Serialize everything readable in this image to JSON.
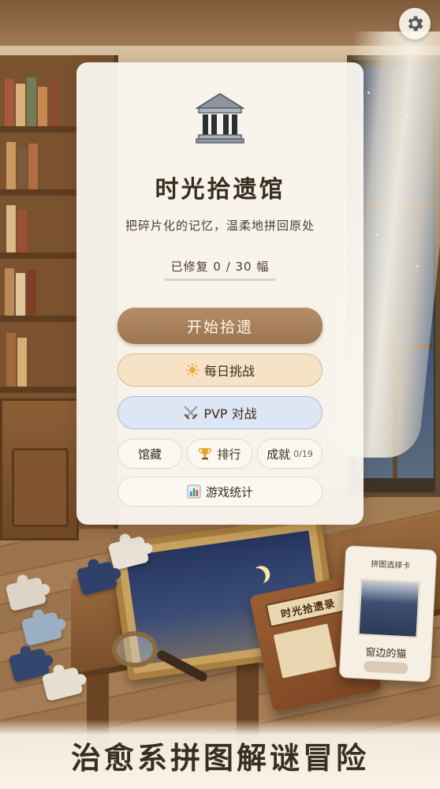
{
  "app": {
    "title": "时光拾遗馆",
    "subtitle": "把碎片化的记忆，温柔地拼回原处"
  },
  "progress": {
    "label": "已修复 0 / 30 幅",
    "restored": 0,
    "total": 30
  },
  "menu": {
    "start_label": "开始拾遗",
    "daily_label": "每日挑战",
    "daily_icon": "sun-icon",
    "pvp_label": "PVP 对战",
    "pvp_icon": "crossed-swords-icon",
    "collection_label": "馆藏",
    "ranking_label": "排行",
    "ranking_icon": "trophy-icon",
    "achievements_label": "成就",
    "achievements_count": "0/19",
    "stats_label": "游戏统计",
    "stats_icon": "bar-chart-icon"
  },
  "settings": {
    "icon": "gear-icon"
  },
  "scene": {
    "journal_title": "时光拾遗录",
    "card_title": "拼图选择卡",
    "card_name": "窗边的猫"
  },
  "banner": {
    "text": "治愈系拼图解谜冒险"
  },
  "colors": {
    "primary_button": "#a88160",
    "daily_button": "#f6e3c6",
    "pvp_button": "#dde6f5",
    "panel": "#faf7f0",
    "text": "#3a2c1f"
  }
}
